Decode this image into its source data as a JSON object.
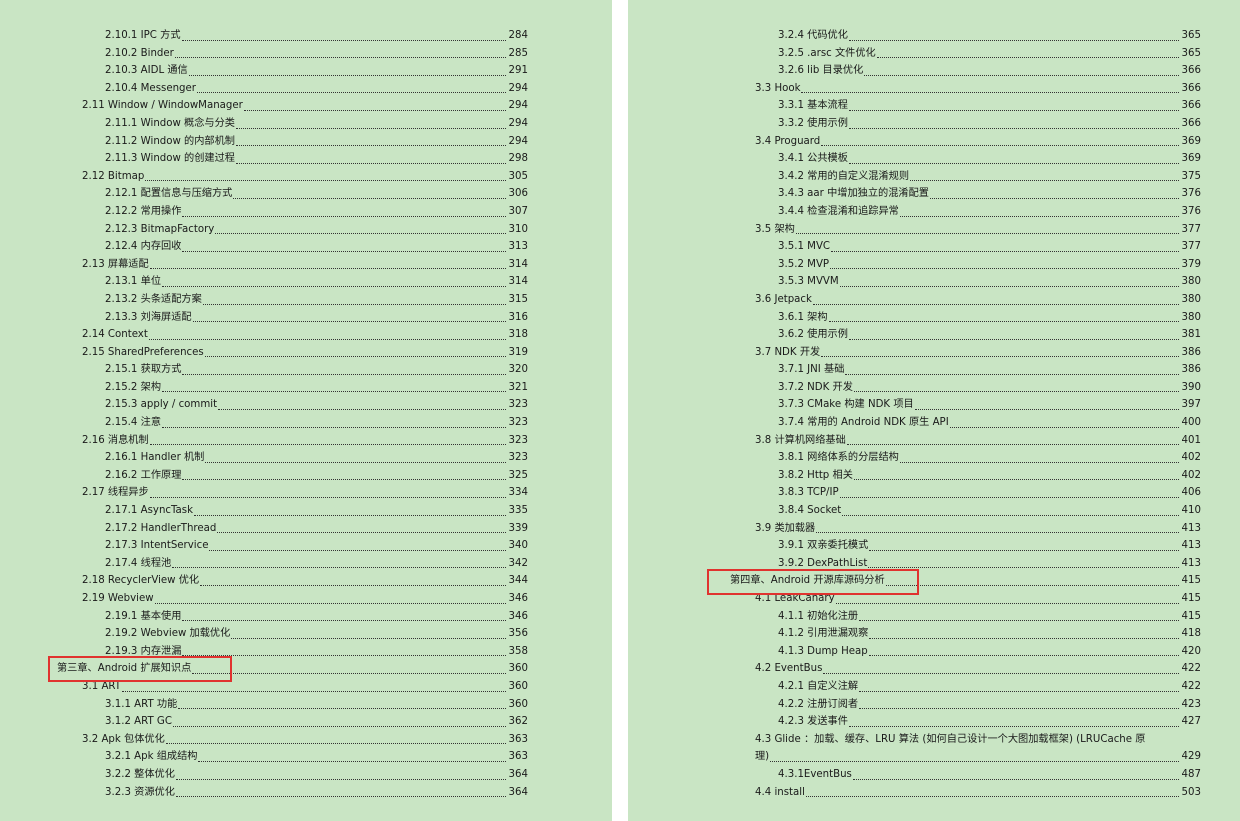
{
  "left_page": {
    "entries": [
      {
        "level": 2,
        "title": "2.10.1 IPC 方式",
        "page": "284"
      },
      {
        "level": 2,
        "title": "2.10.2 Binder",
        "page": "285"
      },
      {
        "level": 2,
        "title": "2.10.3 AIDL 通信",
        "page": "291"
      },
      {
        "level": 2,
        "title": "2.10.4 Messenger",
        "page": "294"
      },
      {
        "level": 1,
        "title": "2.11 Window / WindowManager",
        "page": "294"
      },
      {
        "level": 2,
        "title": "2.11.1 Window 概念与分类",
        "page": "294"
      },
      {
        "level": 2,
        "title": "2.11.2 Window 的内部机制",
        "page": "294"
      },
      {
        "level": 2,
        "title": "2.11.3 Window 的创建过程",
        "page": "298"
      },
      {
        "level": 1,
        "title": "2.12 Bitmap",
        "page": "305"
      },
      {
        "level": 2,
        "title": "2.12.1 配置信息与压缩方式",
        "page": "306"
      },
      {
        "level": 2,
        "title": "2.12.2 常用操作",
        "page": "307"
      },
      {
        "level": 2,
        "title": "2.12.3 BitmapFactory",
        "page": "310"
      },
      {
        "level": 2,
        "title": "2.12.4 内存回收",
        "page": "313"
      },
      {
        "level": 1,
        "title": "2.13 屏幕适配",
        "page": "314"
      },
      {
        "level": 2,
        "title": "2.13.1 单位",
        "page": "314"
      },
      {
        "level": 2,
        "title": "2.13.2 头条适配方案",
        "page": "315"
      },
      {
        "level": 2,
        "title": "2.13.3 刘海屏适配",
        "page": "316"
      },
      {
        "level": 1,
        "title": "2.14 Context",
        "page": "318"
      },
      {
        "level": 1,
        "title": "2.15 SharedPreferences",
        "page": "319"
      },
      {
        "level": 2,
        "title": "2.15.1 获取方式",
        "page": "320"
      },
      {
        "level": 2,
        "title": "2.15.2 架构",
        "page": "321"
      },
      {
        "level": 2,
        "title": "2.15.3 apply / commit",
        "page": "323"
      },
      {
        "level": 2,
        "title": "2.15.4 注意",
        "page": "323"
      },
      {
        "level": 1,
        "title": "2.16 消息机制",
        "page": "323"
      },
      {
        "level": 2,
        "title": "2.16.1 Handler 机制",
        "page": "323"
      },
      {
        "level": 2,
        "title": "2.16.2 工作原理",
        "page": "325"
      },
      {
        "level": 1,
        "title": "2.17 线程异步",
        "page": "334"
      },
      {
        "level": 2,
        "title": "2.17.1 AsyncTask",
        "page": "335"
      },
      {
        "level": 2,
        "title": "2.17.2 HandlerThread",
        "page": "339"
      },
      {
        "level": 2,
        "title": "2.17.3 IntentService",
        "page": "340"
      },
      {
        "level": 2,
        "title": "2.17.4 线程池",
        "page": "342"
      },
      {
        "level": 1,
        "title": "2.18 RecyclerView 优化",
        "page": "344"
      },
      {
        "level": 1,
        "title": "2.19 Webview",
        "page": "346"
      },
      {
        "level": 2,
        "title": "2.19.1 基本使用",
        "page": "346"
      },
      {
        "level": 2,
        "title": "2.19.2 Webview 加载优化",
        "page": "356"
      },
      {
        "level": 2,
        "title": "2.19.3 内存泄漏",
        "page": "358"
      },
      {
        "level": 0,
        "title": "第三章、Android 扩展知识点",
        "page": "360",
        "highlighted": true
      },
      {
        "level": 1,
        "title": "3.1 ART",
        "page": "360"
      },
      {
        "level": 2,
        "title": "3.1.1 ART 功能",
        "page": "360"
      },
      {
        "level": 2,
        "title": "3.1.2 ART GC",
        "page": "362"
      },
      {
        "level": 1,
        "title": "3.2 Apk 包体优化",
        "page": "363"
      },
      {
        "level": 2,
        "title": "3.2.1 Apk 组成结构",
        "page": "363"
      },
      {
        "level": 2,
        "title": "3.2.2 整体优化",
        "page": "364"
      },
      {
        "level": 2,
        "title": "3.2.3 资源优化",
        "page": "364"
      }
    ]
  },
  "right_page": {
    "entries": [
      {
        "level": 2,
        "title": "3.2.4 代码优化",
        "page": "365"
      },
      {
        "level": 2,
        "title": "3.2.5 .arsc 文件优化",
        "page": "365"
      },
      {
        "level": 2,
        "title": "3.2.6 lib 目录优化",
        "page": "366"
      },
      {
        "level": 1,
        "title": "3.3 Hook",
        "page": "366"
      },
      {
        "level": 2,
        "title": "3.3.1 基本流程",
        "page": "366"
      },
      {
        "level": 2,
        "title": "3.3.2 使用示例",
        "page": "366"
      },
      {
        "level": 1,
        "title": "3.4 Proguard",
        "page": "369"
      },
      {
        "level": 2,
        "title": "3.4.1 公共模板",
        "page": "369"
      },
      {
        "level": 2,
        "title": "3.4.2 常用的自定义混淆规则",
        "page": "375"
      },
      {
        "level": 2,
        "title": "3.4.3 aar 中增加独立的混淆配置",
        "page": "376"
      },
      {
        "level": 2,
        "title": "3.4.4 检查混淆和追踪异常",
        "page": "376"
      },
      {
        "level": 1,
        "title": "3.5 架构",
        "page": "377"
      },
      {
        "level": 2,
        "title": "3.5.1 MVC",
        "page": "377"
      },
      {
        "level": 2,
        "title": "3.5.2 MVP",
        "page": "379"
      },
      {
        "level": 2,
        "title": "3.5.3 MVVM",
        "page": "380"
      },
      {
        "level": 1,
        "title": "3.6 Jetpack",
        "page": "380"
      },
      {
        "level": 2,
        "title": "3.6.1 架构",
        "page": "380"
      },
      {
        "level": 2,
        "title": "3.6.2 使用示例",
        "page": "381"
      },
      {
        "level": 1,
        "title": "3.7 NDK 开发",
        "page": "386"
      },
      {
        "level": 2,
        "title": "3.7.1 JNI 基础",
        "page": "386"
      },
      {
        "level": 2,
        "title": "3.7.2 NDK 开发",
        "page": "390"
      },
      {
        "level": 2,
        "title": "3.7.3 CMake 构建 NDK 项目",
        "page": "397"
      },
      {
        "level": 2,
        "title": "3.7.4 常用的 Android NDK 原生 API",
        "page": "400"
      },
      {
        "level": 1,
        "title": "3.8 计算机网络基础",
        "page": "401"
      },
      {
        "level": 2,
        "title": "3.8.1 网络体系的分层结构",
        "page": "402"
      },
      {
        "level": 2,
        "title": "3.8.2 Http 相关",
        "page": "402"
      },
      {
        "level": 2,
        "title": "3.8.3 TCP/IP",
        "page": "406"
      },
      {
        "level": 2,
        "title": "3.8.4 Socket",
        "page": "410"
      },
      {
        "level": 1,
        "title": "3.9 类加载器",
        "page": "413"
      },
      {
        "level": 2,
        "title": "3.9.1 双亲委托模式",
        "page": "413"
      },
      {
        "level": 2,
        "title": "3.9.2 DexPathList",
        "page": "413"
      },
      {
        "level": 0,
        "title": "第四章、Android 开源库源码分析",
        "page": "415",
        "highlighted": true
      },
      {
        "level": 1,
        "title": "4.1 LeakCanary",
        "page": "415"
      },
      {
        "level": 2,
        "title": "4.1.1 初始化注册",
        "page": "415"
      },
      {
        "level": 2,
        "title": "4.1.2 引用泄漏观察",
        "page": "418"
      },
      {
        "level": 2,
        "title": "4.1.3 Dump Heap",
        "page": "420"
      },
      {
        "level": 1,
        "title": "4.2 EventBus",
        "page": "422"
      },
      {
        "level": 2,
        "title": "4.2.1 自定义注解",
        "page": "422"
      },
      {
        "level": 2,
        "title": "4.2.2 注册订阅者",
        "page": "423"
      },
      {
        "level": 2,
        "title": "4.2.3 发送事件",
        "page": "427"
      },
      {
        "level": 1,
        "title": "4.3 Glide ：加载、缓存、LRU 算法 (如何自己设计一个大图加载框架) (LRUCache 原",
        "title_cont": "理)",
        "page": "429",
        "wrapped": true
      },
      {
        "level": 2,
        "title": "4.3.1EventBus",
        "page": "487"
      },
      {
        "level": 1,
        "title": "4.4 install",
        "page": "503"
      }
    ]
  },
  "colors": {
    "page_background": "#c9e5c4",
    "highlight_border": "#e0332f",
    "text": "#1a1a1a"
  }
}
